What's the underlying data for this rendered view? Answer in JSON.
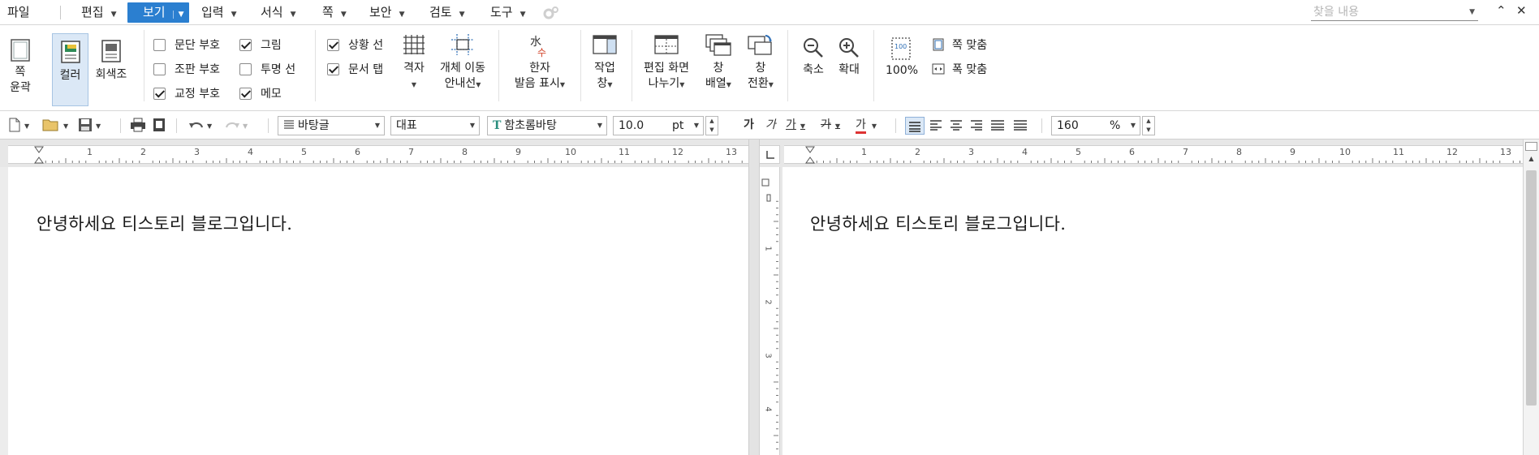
{
  "menubar": {
    "file": "파일",
    "items": [
      {
        "label": "편집"
      },
      {
        "label": "보기"
      },
      {
        "label": "입력"
      },
      {
        "label": "서식"
      },
      {
        "label": "쪽"
      },
      {
        "label": "보안"
      },
      {
        "label": "검토"
      },
      {
        "label": "도구"
      }
    ],
    "find_placeholder": "찾을 내용"
  },
  "ribbon": {
    "page_outline": {
      "line1": "쪽",
      "line2": "윤곽"
    },
    "color": "컬러",
    "grayscale": "회색조",
    "checks": [
      {
        "label": "문단 부호",
        "checked": false
      },
      {
        "label": "조판 부호",
        "checked": false
      },
      {
        "label": "교정 부호",
        "checked": true
      },
      {
        "label": "그림",
        "checked": true
      },
      {
        "label": "투명 선",
        "checked": false
      },
      {
        "label": "메모",
        "checked": true
      },
      {
        "label": "상황 선",
        "checked": true
      },
      {
        "label": "문서 탭",
        "checked": true
      }
    ],
    "grid": "격자",
    "object_move": {
      "line1": "개체 이동",
      "line2": "안내선"
    },
    "hanja": {
      "line1": "한자",
      "line2": "발음 표시"
    },
    "task": {
      "line1": "작업",
      "line2": "창"
    },
    "split": {
      "line1": "편집 화면",
      "line2": "나누기"
    },
    "arrange": {
      "line1": "창",
      "line2": "배열"
    },
    "switch": {
      "line1": "창",
      "line2": "전환"
    },
    "zoom_out": "축소",
    "zoom_in": "확대",
    "zoom_100": "100%",
    "fit_page": "쪽 맞춤",
    "fit_width": "폭 맞춤"
  },
  "toolbar": {
    "style": "바탕글",
    "lang": "대표",
    "font": "함초롬바탕",
    "size": "10.0",
    "unit": "pt",
    "bold": "가",
    "italic": "가",
    "underline": "가",
    "strike": "가",
    "color": "가",
    "zoom": "160",
    "zoom_unit": "%"
  },
  "ruler": {
    "numbers": [
      "1",
      "2",
      "3",
      "4",
      "5",
      "6",
      "7",
      "8",
      "9",
      "10",
      "11",
      "12",
      "13"
    ],
    "vnumbers": [
      "1",
      "2",
      "3",
      "4"
    ]
  },
  "document": {
    "text": "안녕하세요 티스토리 블로그입니다."
  },
  "colors": {
    "accent": "#2b7fd0",
    "selected_bg": "#dbe8f6"
  }
}
